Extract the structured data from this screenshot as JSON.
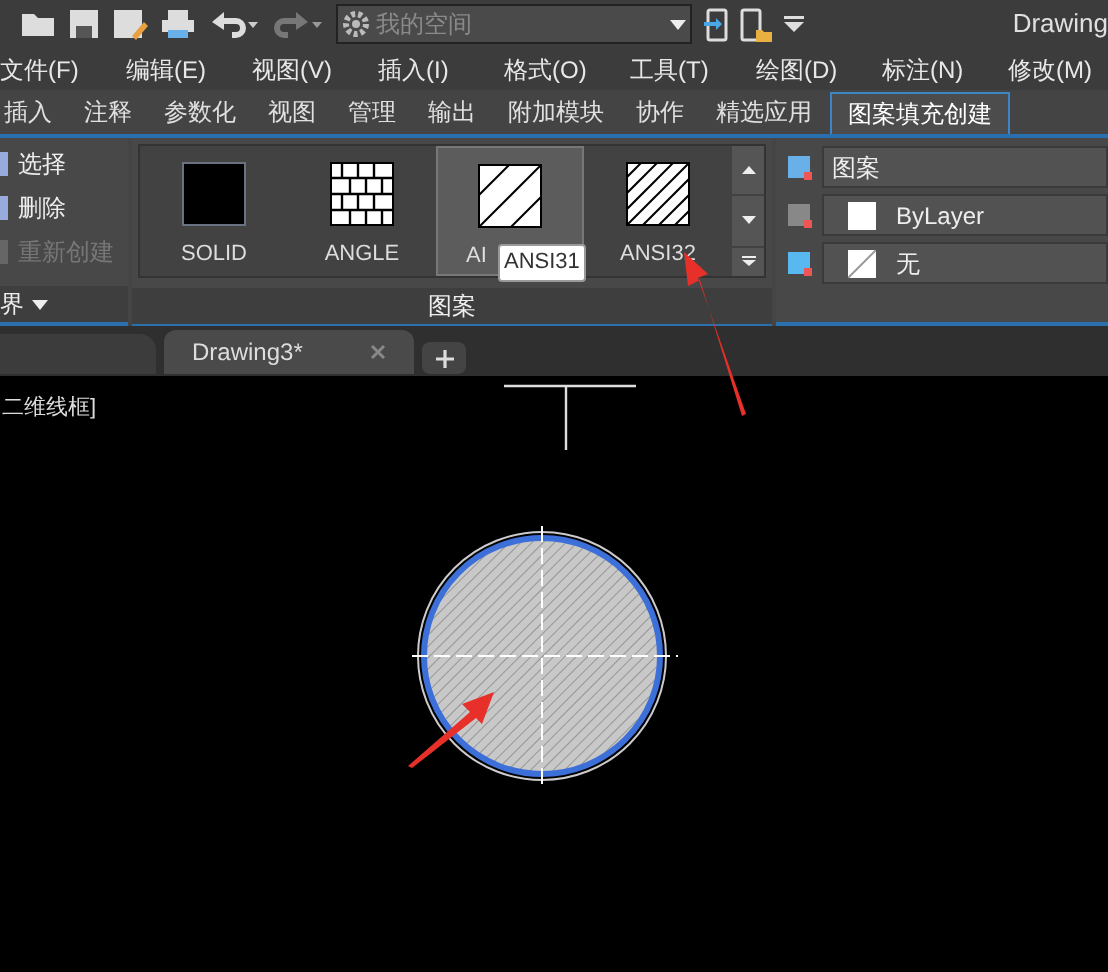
{
  "quick_access": {
    "workspace": {
      "value": "我的空间"
    },
    "title": "Drawing"
  },
  "menu_bar": [
    "文件(F)",
    "编辑(E)",
    "视图(V)",
    "插入(I)",
    "格式(O)",
    "工具(T)",
    "绘图(D)",
    "标注(N)",
    "修改(M)"
  ],
  "ribbon_tabs": [
    {
      "label": "插入",
      "selected": false
    },
    {
      "label": "注释",
      "selected": false
    },
    {
      "label": "参数化",
      "selected": false
    },
    {
      "label": "视图",
      "selected": false
    },
    {
      "label": "管理",
      "selected": false
    },
    {
      "label": "输出",
      "selected": false
    },
    {
      "label": "附加模块",
      "selected": false
    },
    {
      "label": "协作",
      "selected": false
    },
    {
      "label": "精选应用",
      "selected": false
    },
    {
      "label": "图案填充创建",
      "selected": true
    }
  ],
  "boundary_panel": {
    "items": [
      {
        "label": "选择",
        "disabled": false
      },
      {
        "label": "删除",
        "disabled": false
      },
      {
        "label": "重新创建",
        "disabled": true
      }
    ],
    "footer": "界"
  },
  "pattern_panel": {
    "patterns": [
      {
        "label": "SOLID",
        "kind": "solid",
        "selected": false
      },
      {
        "label": "ANGLE",
        "kind": "grid",
        "selected": false
      },
      {
        "label": "AI",
        "kind": "hatch",
        "selected": true
      },
      {
        "label": "ANSI32",
        "kind": "double",
        "selected": false
      }
    ],
    "tooltip": "ANSI31",
    "footer": "图案"
  },
  "properties_panel": {
    "type": "图案",
    "foreground": "ByLayer",
    "background": "无"
  },
  "document_tabs": [
    {
      "label": "Drawing3*",
      "selected": true
    }
  ],
  "viewport": {
    "label": "二维线框]"
  }
}
